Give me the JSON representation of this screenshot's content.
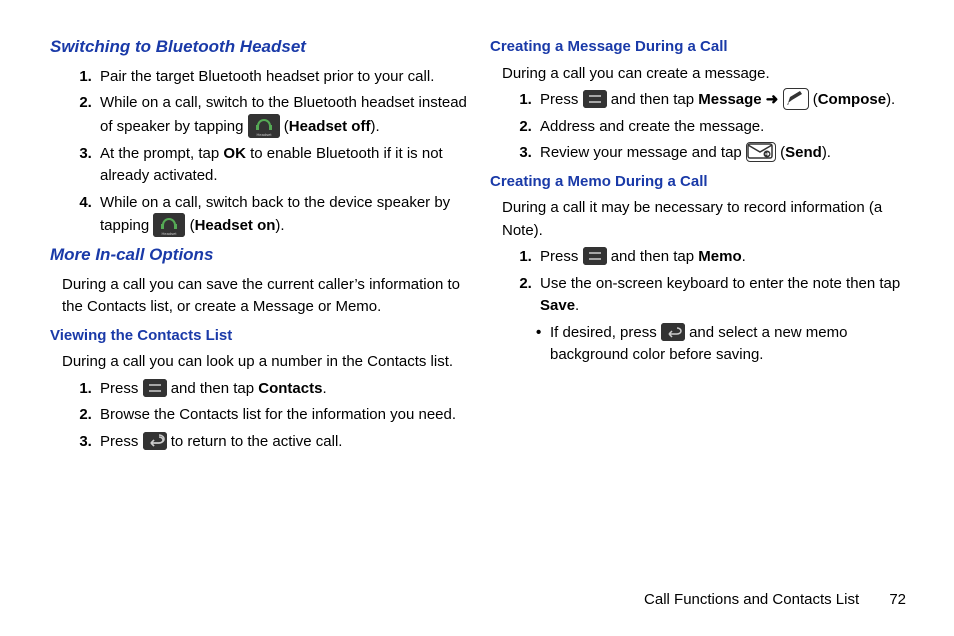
{
  "left": {
    "sec1": {
      "title": "Switching to Bluetooth Headset",
      "steps": [
        {
          "pre": "Pair the target Bluetooth headset prior to your call."
        },
        {
          "pre": "While on a call, switch to the Bluetooth headset instead of speaker by tapping ",
          "icon": "headset",
          "post_open": " (",
          "bold": "Headset off",
          "post_close": ")."
        },
        {
          "pre": "At the prompt, tap ",
          "bold": "OK",
          "post": " to enable Bluetooth if it is not already activated."
        },
        {
          "pre": "While on a call, switch back to the device speaker by tapping ",
          "icon": "headset",
          "post_open": " (",
          "bold2": "Headset on",
          "post_close": ")."
        }
      ]
    },
    "sec2": {
      "title": "More In-call Options",
      "intro": "During a call you can save the current caller’s information to the Contacts list, or create a Message or Memo."
    },
    "sub1": {
      "title": "Viewing the Contacts List",
      "intro": "During a call you can look up a number in the Contacts list.",
      "steps": [
        {
          "pre": "Press ",
          "icon": "menu",
          "post": " and then tap ",
          "bold": "Contacts",
          "tail": "."
        },
        {
          "pre": "Browse the Contacts list for the information you need."
        },
        {
          "pre": "Press ",
          "icon": "back",
          "post": " to return to the active call."
        }
      ]
    }
  },
  "right": {
    "sub2": {
      "title": "Creating a Message During a Call",
      "intro": "During a call you can create a message.",
      "steps": [
        {
          "pre": "Press ",
          "icon": "menu",
          "post": " and then tap ",
          "bold": "Message",
          "arrow": " ➜ ",
          "icon2": "compose",
          "post2": " (",
          "bold2": "Compose",
          "tail": ")."
        },
        {
          "pre": "Address and create the message."
        },
        {
          "pre": "Review your message and tap ",
          "icon": "send",
          "post": " (",
          "bold": "Send",
          "tail": ")."
        }
      ]
    },
    "sub3": {
      "title": "Creating a Memo During a Call",
      "intro": "During a call it may be necessary to record information (a Note).",
      "steps": [
        {
          "pre": "Press ",
          "icon": "menu",
          "post": " and then tap ",
          "bold": "Memo",
          "tail": "."
        },
        {
          "pre": "Use the on-screen keyboard to enter the note then tap ",
          "bold": "Save",
          "tail": "."
        }
      ],
      "bullet": {
        "pre": "If desired, press ",
        "icon": "back",
        "post": " and select a new memo background color before saving."
      }
    }
  },
  "footer": {
    "chapter": "Call Functions and Contacts List",
    "page": "72"
  }
}
